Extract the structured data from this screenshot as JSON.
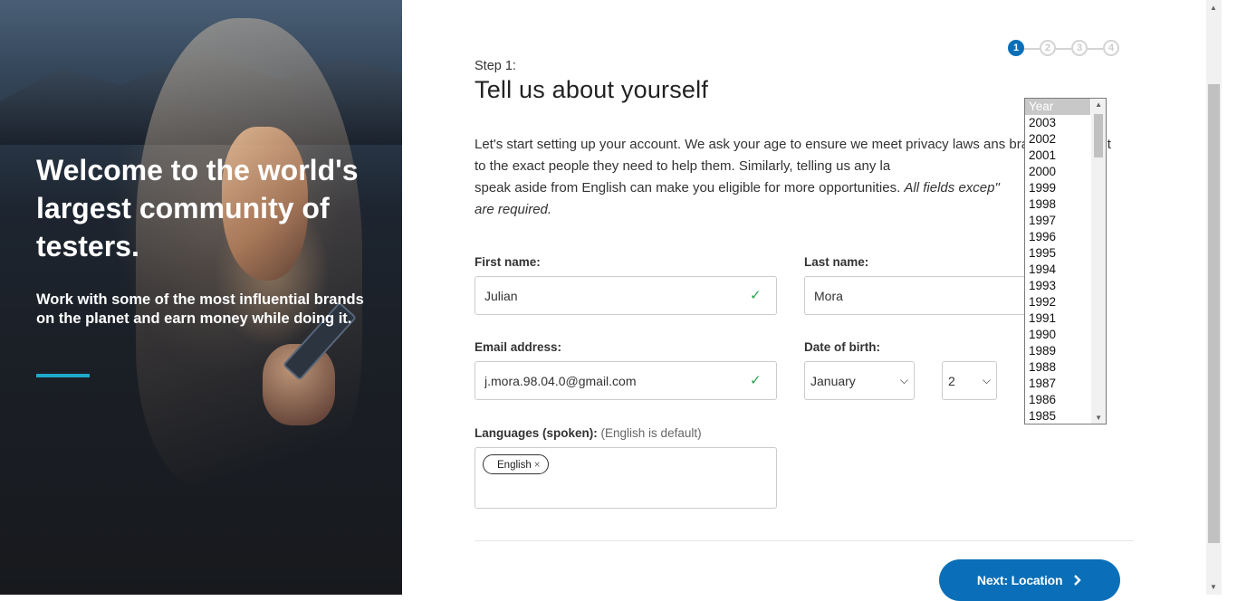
{
  "hero": {
    "title": "Welcome to the world's largest community of testers.",
    "subtitle": "Work with some of the most influential brands on the planet and earn money while doing it."
  },
  "stepper": {
    "steps": [
      "1",
      "2",
      "3",
      "4"
    ],
    "active_step": 1
  },
  "form": {
    "step_label": "Step 1:",
    "title": "Tell us about yourself",
    "intro_text": "Let's start setting up your account. We ask your age to ensure we meet privacy laws an",
    "intro_text_2": "s brands reach out to the exact people they need to help them. Similarly, telling us any la",
    "intro_text_3": "speak aside from English can make you eligible for more opportunities. ",
    "intro_emph_1": "All fields excep",
    "intro_emph_2": "\"",
    "intro_emph_3": "are required."
  },
  "fields": {
    "first_name_label": "First name:",
    "first_name_value": "Julian",
    "last_name_label": "Last name:",
    "last_name_value": "Mora",
    "email_label": "Email address:",
    "email_value": "j.mora.98.04.0@gmail.com",
    "dob_label": "Date of birth:",
    "dob_month": "January",
    "dob_day": "2",
    "languages_label": "Languages (spoken):",
    "languages_hint": "(English is default)",
    "languages": [
      "English"
    ],
    "tag_remove": "×"
  },
  "year_dropdown": {
    "options": [
      "Year",
      "2003",
      "2002",
      "2001",
      "2000",
      "1999",
      "1998",
      "1997",
      "1996",
      "1995",
      "1994",
      "1993",
      "1992",
      "1991",
      "1990",
      "1989",
      "1988",
      "1987",
      "1986",
      "1985"
    ],
    "selected": "Year"
  },
  "actions": {
    "next_label": "Next: Location",
    "next_icon": "chevron-right-icon"
  },
  "colors": {
    "primary": "#0a6fb8",
    "accent_bar": "#1fa9c9",
    "valid_check": "#2aa24c"
  }
}
